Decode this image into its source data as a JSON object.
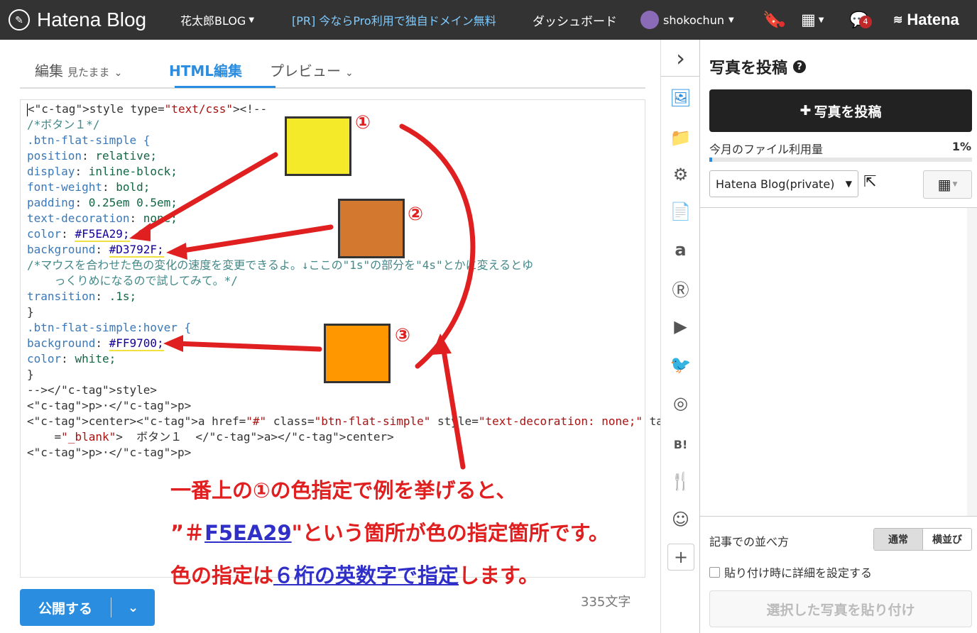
{
  "header": {
    "logo": "Hatena Blog",
    "blog_name": "花太郎BLOG",
    "promo": "[PR] 今ならPro利用で独自ドメイン無料",
    "dashboard": "ダッシュボード",
    "username": "shokochun",
    "notification_count": "4",
    "brand": "Hatena"
  },
  "tabs": {
    "edit": "編集",
    "edit_mode": "見たまま",
    "html": "HTML編集",
    "preview": "プレビュー"
  },
  "code_lines": [
    "<style type=\"text/css\"><!--",
    "/*ボタン１*/",
    ".btn-flat-simple {",
    "position: relative;",
    "display: inline-block;",
    "font-weight: bold;",
    "padding: 0.25em 0.5em;",
    "text-decoration: none;",
    "color: #F5EA29;",
    "background: #D3792F;",
    "/*マウスを合わせた色の変化の速度を変更できるよ。↓ここの\"1s\"の部分を\"4s\"とかに変えるとゆ",
    "    っくりめになるので試してみて。*/",
    "transition: .1s;",
    "}",
    ".btn-flat-simple:hover {",
    "background: #FF9700;",
    "color: white;",
    "}",
    "--></style>",
    "<p>·</p>",
    "<center><a href=\"#\" class=\"btn-flat-simple\" style=\"text-decoration: none;\" target",
    "    =\"_blank\">  ボタン１  </a></center>",
    "<p>·</p>"
  ],
  "swatches": [
    {
      "label": "①",
      "color": "#F5EA29"
    },
    {
      "label": "②",
      "color": "#D3792F"
    },
    {
      "label": "③",
      "color": "#FF9700"
    }
  ],
  "annotation": {
    "line1": "一番上の①の色指定で例を挙げると、",
    "line2_pre": "”＃",
    "line2_hex": "F5EA29",
    "line2_post": "\"という箇所が色の指定箇所です。",
    "line3_pre": "色の指定は",
    "line3_em": "６桁の英数字で指定",
    "line3_post": "します。"
  },
  "footer": {
    "publish": "公開する",
    "char_count": "335文字"
  },
  "panel": {
    "title": "写真を投稿",
    "post_button": "写真を投稿",
    "usage_label": "今月のファイル利用量",
    "usage_percent": "1%",
    "usage_fraction": 0.01,
    "album": "Hatena Blog(private)",
    "sort_label": "記事での並べ方",
    "sort_normal": "通常",
    "sort_side": "横並び",
    "detail_label": "貼り付け時に詳細を設定する",
    "paste_button": "選択した写真を貼り付け"
  },
  "colors": {
    "accent": "#2b8de0",
    "annotation_red": "#e02020",
    "annotation_blue": "#3030c8"
  }
}
